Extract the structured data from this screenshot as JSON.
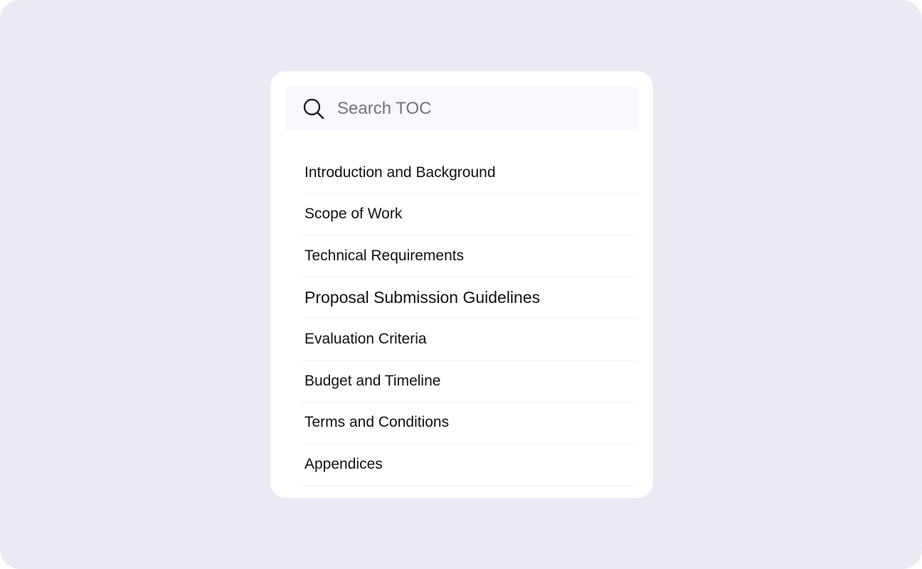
{
  "search": {
    "placeholder": "Search TOC",
    "icon": "search-icon"
  },
  "toc": {
    "items": [
      {
        "label": "Introduction and Background"
      },
      {
        "label": "Scope of Work"
      },
      {
        "label": "Technical Requirements"
      },
      {
        "label": "Proposal Submission Guidelines"
      },
      {
        "label": "Evaluation Criteria"
      },
      {
        "label": "Budget and Timeline"
      },
      {
        "label": "Terms and Conditions"
      },
      {
        "label": "Appendices"
      }
    ]
  },
  "colors": {
    "background": "#ebe9f3",
    "card": "#ffffff",
    "search_bg": "#f9f8fc",
    "text": "#111111",
    "placeholder": "#74737d"
  }
}
